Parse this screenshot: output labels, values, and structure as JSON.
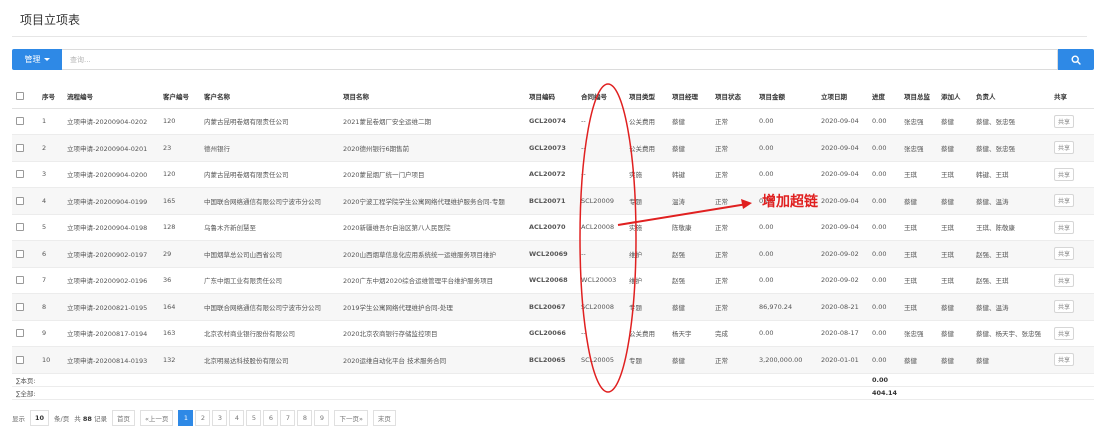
{
  "page": {
    "title": "项目立项表"
  },
  "toolbar": {
    "manage_label": "管理",
    "search_placeholder": "查询..."
  },
  "columns": [
    "序号",
    "流程编号",
    "客户编号",
    "客户名称",
    "项目名称",
    "项目编码",
    "合同编号",
    "项目类型",
    "项目经理",
    "项目状态",
    "项目金额",
    "立项日期",
    "进度",
    "项目总监",
    "添加人",
    "负责人",
    "共享"
  ],
  "rows": [
    {
      "no": "1",
      "flow": "立项申请-20200904-0202",
      "cust_no": "120",
      "cust_name": "内蒙古昆明卷烟有限责任公司",
      "project": "2021蒙昆卷烟厂安全运维二期",
      "code": "GCL20074",
      "contract": "--",
      "type": "公关费用",
      "manager": "蔡健",
      "status": "正常",
      "amount": "0.00",
      "date": "2020-09-04",
      "progress": "0.00",
      "director": "张忠强",
      "adder": "蔡健",
      "owner": "蔡健、张忠强",
      "share": "共享"
    },
    {
      "no": "2",
      "flow": "立项申请-20200904-0201",
      "cust_no": "23",
      "cust_name": "德州银行",
      "project": "2020德州银行6期售前",
      "code": "GCL20073",
      "contract": "--",
      "type": "公关费用",
      "manager": "蔡健",
      "status": "正常",
      "amount": "0.00",
      "date": "2020-09-04",
      "progress": "0.00",
      "director": "张忠强",
      "adder": "蔡健",
      "owner": "蔡健、张忠强",
      "share": "共享"
    },
    {
      "no": "3",
      "flow": "立项申请-20200904-0200",
      "cust_no": "120",
      "cust_name": "内蒙古昆明卷烟有限责任公司",
      "project": "2020蒙昆烟厂统一门户项目",
      "code": "ACL20072",
      "contract": "--",
      "type": "实施",
      "manager": "韩键",
      "status": "正常",
      "amount": "0.00",
      "date": "2020-09-04",
      "progress": "0.00",
      "director": "王琪",
      "adder": "王琪",
      "owner": "韩键、王琪",
      "share": "共享"
    },
    {
      "no": "4",
      "flow": "立项申请-20200904-0199",
      "cust_no": "165",
      "cust_name": "中国联合网络通信有限公司宁波市分公司",
      "project": "2020宁波工程学院学生公寓网络代理维护服务合同-专题",
      "code": "BCL20071",
      "contract": "SCL20009",
      "type": "专题",
      "manager": "温涛",
      "status": "正常",
      "amount": "0.00",
      "date": "2020-09-04",
      "progress": "0.00",
      "director": "蔡健",
      "adder": "蔡健",
      "owner": "蔡健、温涛",
      "share": "共享"
    },
    {
      "no": "5",
      "flow": "立项申请-20200904-0198",
      "cust_no": "128",
      "cust_name": "乌鲁木齐新创慧至",
      "project": "2020新疆维吾尔自治区第八人民医院",
      "code": "ACL20070",
      "contract": "ACL20008",
      "type": "实施",
      "manager": "陈敬康",
      "status": "正常",
      "amount": "0.00",
      "date": "2020-09-04",
      "progress": "0.00",
      "director": "王琪",
      "adder": "王琪",
      "owner": "王琪、陈敬康",
      "share": "共享"
    },
    {
      "no": "6",
      "flow": "立项申请-20200902-0197",
      "cust_no": "29",
      "cust_name": "中国烟草总公司山西省公司",
      "project": "2020山西烟草信息化应用系统统一运维服务项目维护",
      "code": "WCL20069",
      "contract": "--",
      "type": "维护",
      "manager": "赵强",
      "status": "正常",
      "amount": "0.00",
      "date": "2020-09-02",
      "progress": "0.00",
      "director": "王琪",
      "adder": "王琪",
      "owner": "赵强、王琪",
      "share": "共享"
    },
    {
      "no": "7",
      "flow": "立项申请-20200902-0196",
      "cust_no": "36",
      "cust_name": "广东中烟工业有限责任公司",
      "project": "2020广东中烟2020综合运维管理平台维护服务项目",
      "code": "WCL20068",
      "contract": "WCL20003",
      "type": "维护",
      "manager": "赵强",
      "status": "正常",
      "amount": "0.00",
      "date": "2020-09-02",
      "progress": "0.00",
      "director": "王琪",
      "adder": "王琪",
      "owner": "赵强、王琪",
      "share": "共享"
    },
    {
      "no": "8",
      "flow": "立项申请-20200821-0195",
      "cust_no": "164",
      "cust_name": "中国联合网络通信有限公司宁波市分公司",
      "project": "2019学生公寓网络代理维护合同-处理",
      "code": "BCL20067",
      "contract": "SCL20008",
      "type": "专题",
      "manager": "蔡健",
      "status": "正常",
      "amount": "86,970.24",
      "date": "2020-08-21",
      "progress": "0.00",
      "director": "王琪",
      "adder": "蔡健",
      "owner": "蔡健、温涛",
      "share": "共享"
    },
    {
      "no": "9",
      "flow": "立项申请-20200817-0194",
      "cust_no": "163",
      "cust_name": "北京农村商业银行股份有限公司",
      "project": "2020北京农商银行存储监控项目",
      "code": "GCL20066",
      "contract": "--",
      "type": "公关费用",
      "manager": "杨天宇",
      "status": "完成",
      "amount": "0.00",
      "date": "2020-08-17",
      "progress": "0.00",
      "director": "张忠强",
      "adder": "蔡健",
      "owner": "蔡健、杨天宇、张忠强",
      "share": "共享"
    },
    {
      "no": "10",
      "flow": "立项申请-20200814-0193",
      "cust_no": "132",
      "cust_name": "北京明易达科技股份有限公司",
      "project": "2020运维自动化平台 技术服务合同",
      "code": "BCL20065",
      "contract": "SCL20005",
      "type": "专题",
      "manager": "蔡健",
      "status": "正常",
      "amount": "3,200,000.00",
      "date": "2020-01-01",
      "progress": "0.00",
      "director": "蔡健",
      "adder": "蔡健",
      "owner": "蔡健",
      "share": "共享"
    }
  ],
  "summary": {
    "page_label": "∑本页:",
    "page_value": "0.00",
    "total_label": "∑全部:",
    "total_value": "404.14"
  },
  "pager": {
    "show_label": "显示",
    "page_size": "10",
    "per_page": "条/页",
    "total_prefix": "共",
    "total_count": "88",
    "total_suffix": "记录",
    "first": "首页",
    "prev": "«上一页",
    "pages": [
      "1",
      "2",
      "3",
      "4",
      "5",
      "6",
      "7",
      "8",
      "9"
    ],
    "next": "下一页»",
    "last": "末页"
  },
  "annotation": {
    "text": "增加超链",
    "color": "#e02020"
  }
}
